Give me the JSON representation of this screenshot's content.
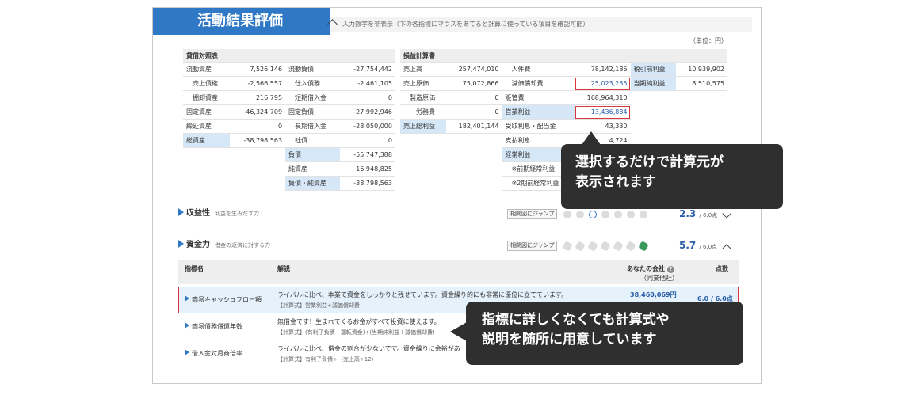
{
  "title": "活動結果評価",
  "hint": "入力数字を非表示（下の各指標にマウスをあてると計算に使っている項目を確認可能）",
  "unit": "（単位：円）",
  "balance_sheet": {
    "header": "貸借対照表",
    "rows": [
      {
        "l1": "流動資産",
        "v1": "7,526,146",
        "l2": "流動負債",
        "v2": "-27,754,442"
      },
      {
        "l1": "売上債権",
        "v1": "-2,566,557",
        "l2": "仕入債務",
        "v2": "-2,461,105"
      },
      {
        "l1": "棚卸資産",
        "v1": "216,795",
        "l2": "短期借入金",
        "v2": "0"
      },
      {
        "l1": "固定資産",
        "v1": "-46,324,709",
        "l2": "固定負債",
        "v2": "-27,992,946"
      },
      {
        "l1": "繰延資産",
        "v1": "0",
        "l2": "長期借入金",
        "v2": "-28,050,000"
      },
      {
        "l1": "総資産",
        "v1": "-38,798,563",
        "l2": "社債",
        "v2": "0"
      },
      {
        "l1": "",
        "v1": "",
        "l2": "負債",
        "v2": "-55,747,388"
      },
      {
        "l1": "",
        "v1": "",
        "l2": "純資産",
        "v2": "16,948,825"
      },
      {
        "l1": "",
        "v1": "",
        "l2": "負債・純資産",
        "v2": "-38,798,563"
      }
    ]
  },
  "income_statement": {
    "header": "損益計算書",
    "rows": [
      {
        "l1": "売上高",
        "v1": "257,474,010",
        "l2": "人件費",
        "v2": "78,142,186",
        "l3": "税引前利益",
        "v3": "10,939,902"
      },
      {
        "l1": "売上原価",
        "v1": "75,072,866",
        "l2": "減価償却費",
        "v2": "25,023,235",
        "l3": "当期純利益",
        "v3": "8,510,575"
      },
      {
        "l1": "製造原価",
        "v1": "0",
        "l2": "販管費",
        "v2": "168,964,310",
        "l3": "",
        "v3": ""
      },
      {
        "l1": "労務費",
        "v1": "0",
        "l2": "営業利益",
        "v2": "13,436,834",
        "l3": "",
        "v3": ""
      },
      {
        "l1": "売上総利益",
        "v1": "182,401,144",
        "l2": "受取利息・配当金",
        "v2": "43,330",
        "l3": "",
        "v3": ""
      },
      {
        "l1": "",
        "v1": "",
        "l2": "支払利息",
        "v2": "4,724",
        "l3": "",
        "v3": ""
      },
      {
        "l1": "",
        "v1": "",
        "l2": "経常利益",
        "v2": "",
        "l3": "",
        "v3": ""
      },
      {
        "l1": "",
        "v1": "",
        "l2": "※前期経常利益",
        "v2": "",
        "l3": "",
        "v3": ""
      },
      {
        "l1": "",
        "v1": "",
        "l2": "※2期前経常利益",
        "v2": "",
        "l3": "",
        "v3": ""
      }
    ]
  },
  "sections": [
    {
      "name": "収益性",
      "sub": "利益を生みだす力",
      "jump": "相関図にジャンプ",
      "score": "2.3",
      "max": "/ 6.0点"
    },
    {
      "name": "資金力",
      "sub": "借金の返済に対する力",
      "jump": "相関図にジャンプ",
      "score": "5.7",
      "max": "/ 6.0点"
    }
  ],
  "indicator_table": {
    "col_name": "指標名",
    "col_desc": "解説",
    "col_company": "あなたの会社",
    "col_company_sub": "（同業他社）",
    "col_points": "点数",
    "rows": [
      {
        "name": "簡易キャッシュフロー額",
        "desc": "ライバルに比べ、本業で資金をしっかりと残せています。資金繰り的にも非常に優位に立てています。",
        "formula": "【計算式】営業利益+減価償却費",
        "value": "38,460,069円",
        "points": "6.0 / 6.0点"
      },
      {
        "name": "簡易債務償還年数",
        "desc": "無借金です！生まれてくるお金がすべて投資に使えます。",
        "formula": "【計算式】(有利子負債－運転資金)÷(当期純利益＋減価償却費)",
        "value": "",
        "points": ""
      },
      {
        "name": "借入金対月商倍率",
        "desc": "ライバルに比べ、借金の割合が少ないです。資金繰りに余裕があ",
        "formula": "【計算式】有利子負債÷（売上高÷12）",
        "value": "",
        "points": ""
      }
    ]
  },
  "callouts": {
    "c1": [
      "選択するだけで計算元が",
      "表示されます"
    ],
    "c2": [
      "指標に詳しくなくても計算式や",
      "説明を随所に用意しています"
    ]
  },
  "colors": {
    "accent": "#2e78c6",
    "highlight": "#d6e7f7",
    "alert": "#d9363e",
    "callout_bg": "#2f2f2f"
  }
}
